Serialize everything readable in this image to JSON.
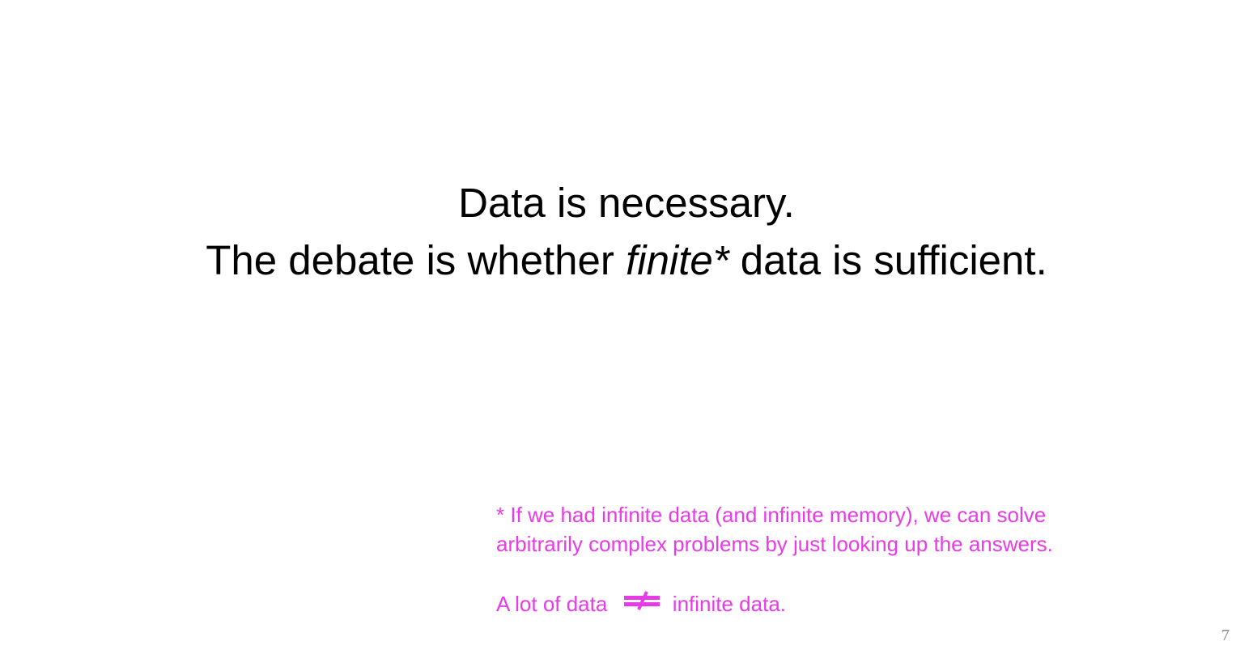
{
  "slide": {
    "headline": {
      "line1": "Data is necessary.",
      "line2_prefix": "The debate is whether ",
      "line2_emphasis": "finite*",
      "line2_suffix": " data is sufficient."
    },
    "footnote": {
      "line1": "* If we had infinite data (and infinite memory), we can solve",
      "line2": "arbitrarily complex problems by just looking up the answers.",
      "comparison_left": "A lot of data",
      "comparison_icon": "not-equal-icon",
      "comparison_right": "infinite data."
    },
    "page_number": "7"
  },
  "colors": {
    "headline": "#000000",
    "accent": "#e83be8",
    "page_number": "#888888",
    "background": "#ffffff"
  }
}
